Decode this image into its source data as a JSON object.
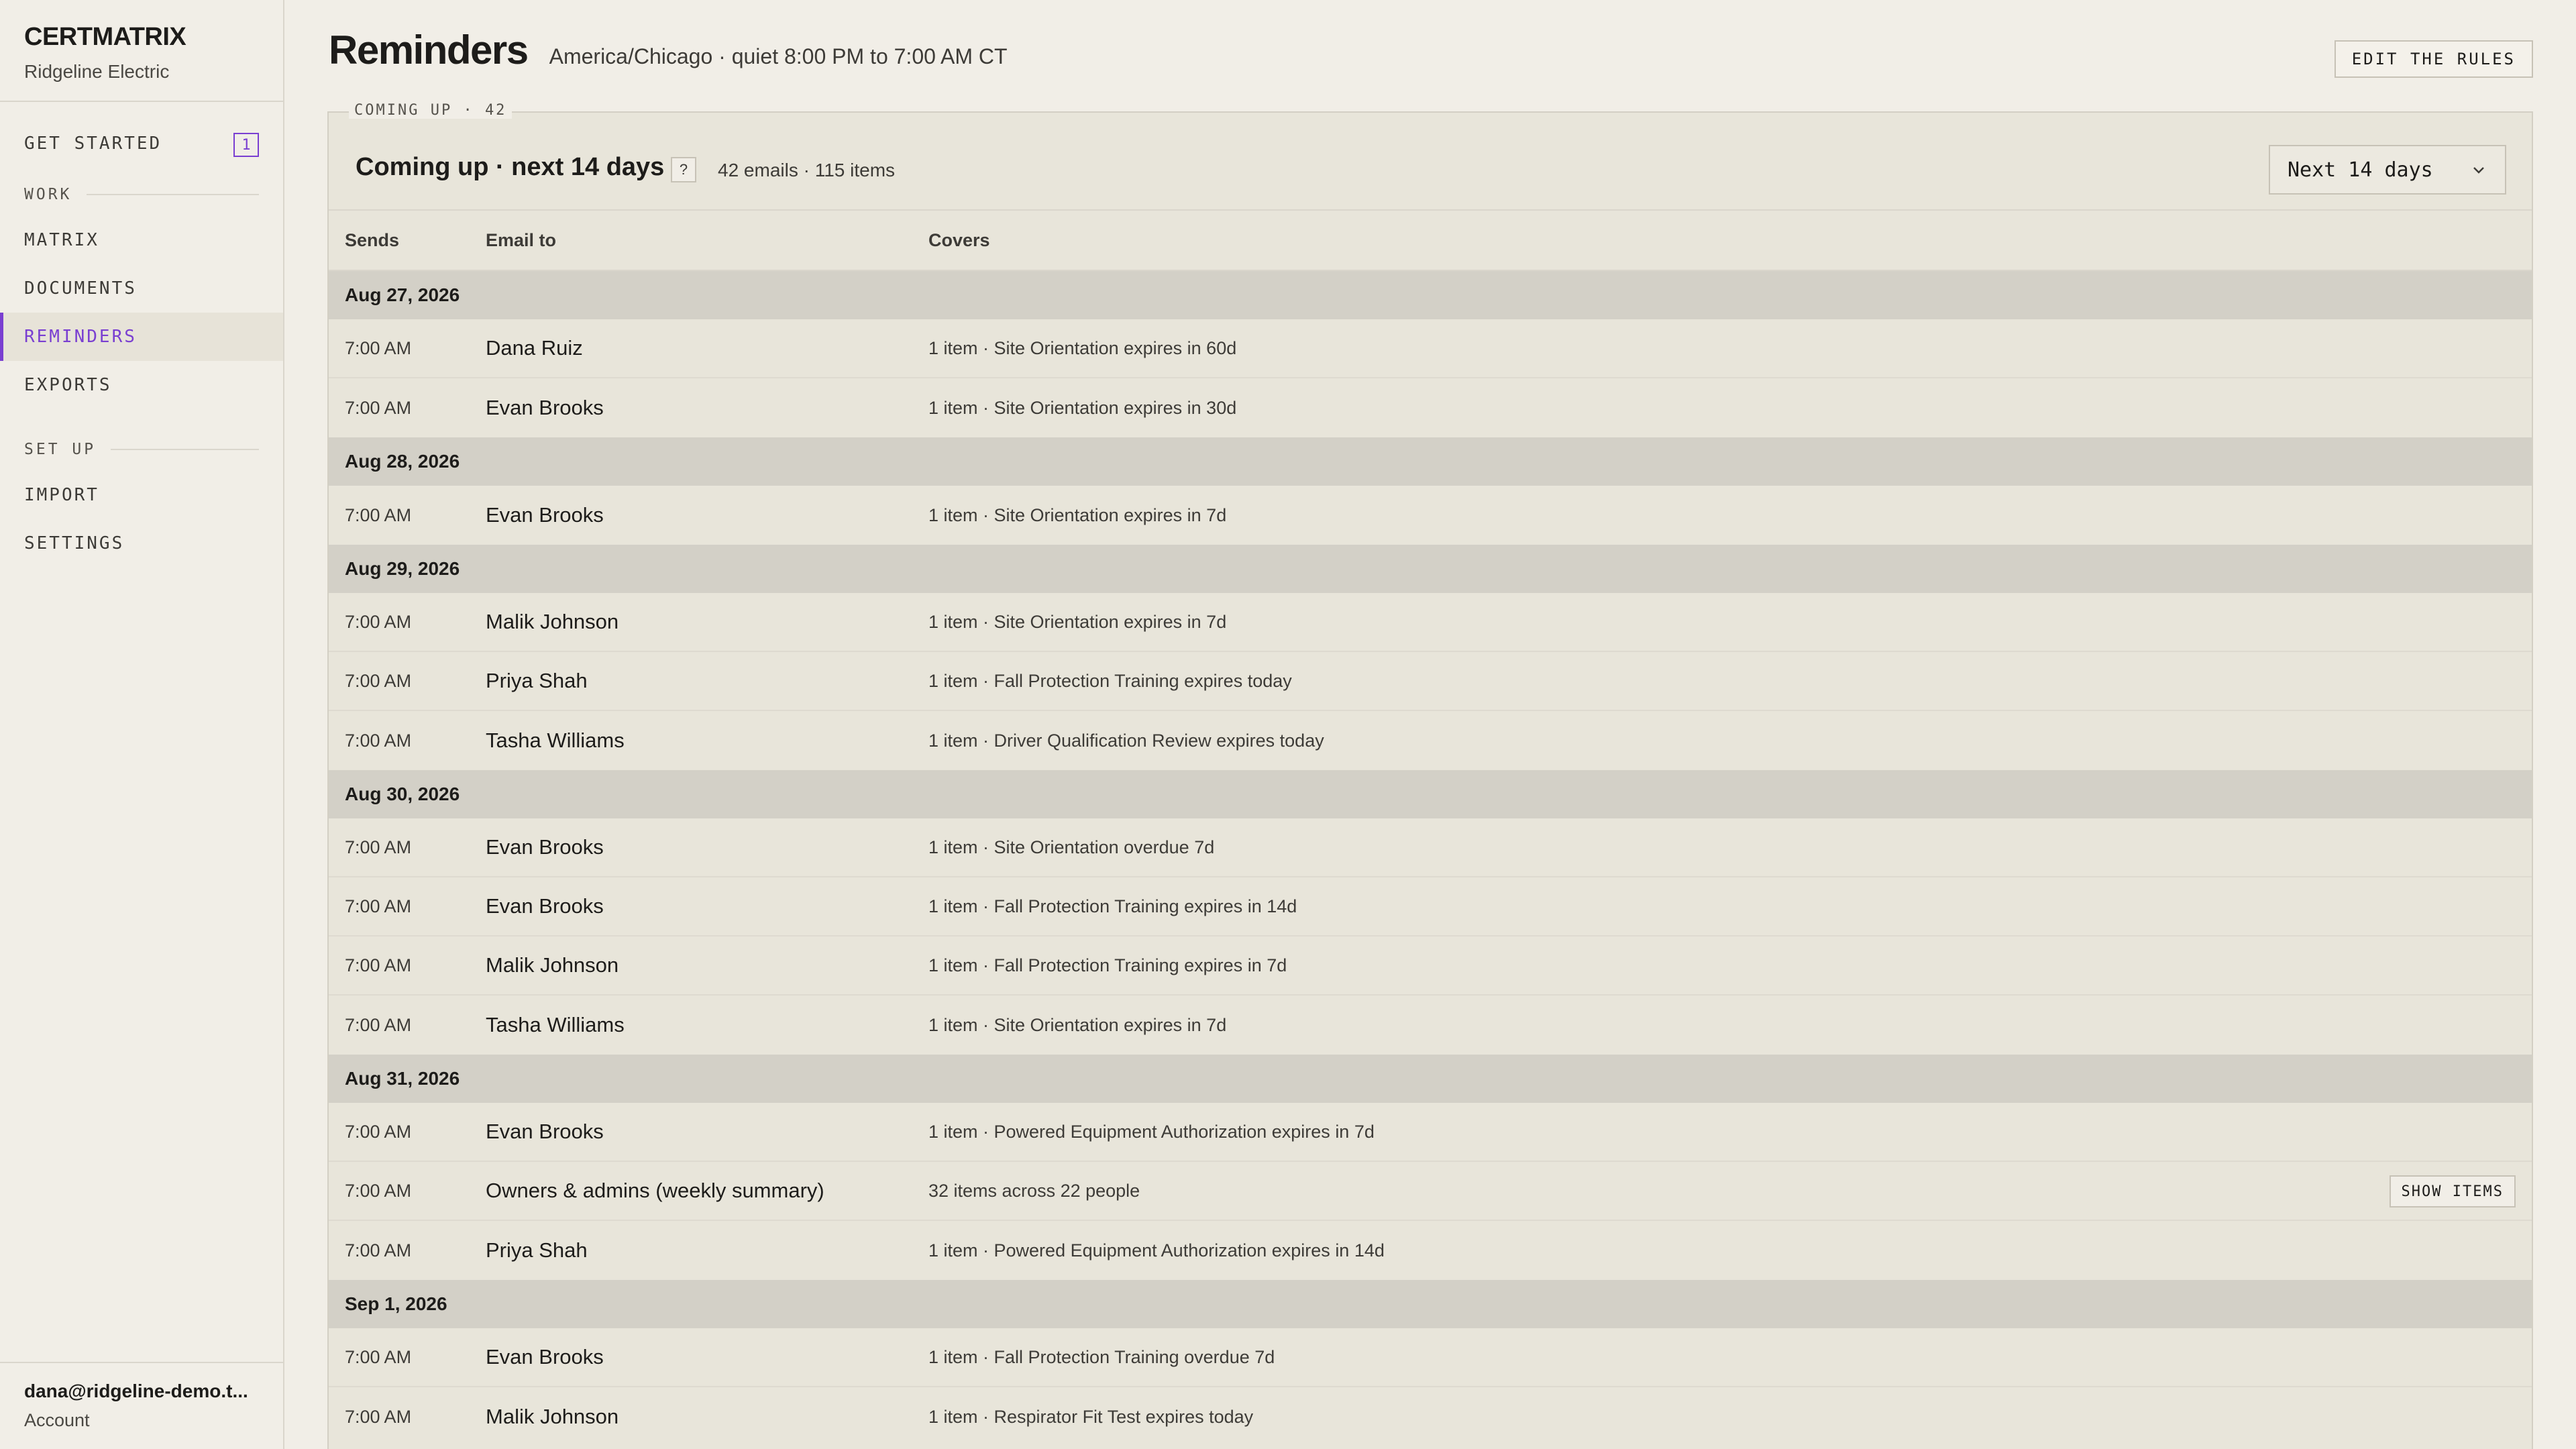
{
  "brand": {
    "name": "CERTMATRIX",
    "org": "Ridgeline Electric"
  },
  "sidebar": {
    "get_started": {
      "label": "GET STARTED",
      "badge": "1"
    },
    "sections": [
      {
        "label": "WORK",
        "items": [
          {
            "label": "MATRIX",
            "active": false
          },
          {
            "label": "DOCUMENTS",
            "active": false
          },
          {
            "label": "REMINDERS",
            "active": true
          },
          {
            "label": "EXPORTS",
            "active": false
          }
        ]
      },
      {
        "label": "SET UP",
        "items": [
          {
            "label": "IMPORT",
            "active": false
          },
          {
            "label": "SETTINGS",
            "active": false
          }
        ]
      }
    ],
    "account": {
      "email": "dana@ridgeline-demo.t...",
      "label": "Account"
    }
  },
  "header": {
    "title": "Reminders",
    "subtitle": "America/Chicago · quiet 8:00 PM to 7:00 AM CT",
    "edit_button": "EDIT THE RULES"
  },
  "panel": {
    "legend": "COMING UP · 42",
    "title": "Coming up · next 14 days",
    "help": "?",
    "meta": "42 emails · 115 items",
    "range_value": "Next 14 days",
    "columns": {
      "sends": "Sends",
      "to": "Email to",
      "covers": "Covers"
    },
    "show_items_label": "SHOW ITEMS",
    "groups": [
      {
        "date": "Aug 27, 2026",
        "rows": [
          {
            "time": "7:00 AM",
            "to": "Dana Ruiz",
            "covers": "1 item · Site Orientation expires in 60d"
          },
          {
            "time": "7:00 AM",
            "to": "Evan Brooks",
            "covers": "1 item · Site Orientation expires in 30d"
          }
        ]
      },
      {
        "date": "Aug 28, 2026",
        "rows": [
          {
            "time": "7:00 AM",
            "to": "Evan Brooks",
            "covers": "1 item · Site Orientation expires in 7d"
          }
        ]
      },
      {
        "date": "Aug 29, 2026",
        "rows": [
          {
            "time": "7:00 AM",
            "to": "Malik Johnson",
            "covers": "1 item · Site Orientation expires in 7d"
          },
          {
            "time": "7:00 AM",
            "to": "Priya Shah",
            "covers": "1 item · Fall Protection Training expires today"
          },
          {
            "time": "7:00 AM",
            "to": "Tasha Williams",
            "covers": "1 item · Driver Qualification Review expires today"
          }
        ]
      },
      {
        "date": "Aug 30, 2026",
        "rows": [
          {
            "time": "7:00 AM",
            "to": "Evan Brooks",
            "covers": "1 item · Site Orientation overdue 7d"
          },
          {
            "time": "7:00 AM",
            "to": "Evan Brooks",
            "covers": "1 item · Fall Protection Training expires in 14d"
          },
          {
            "time": "7:00 AM",
            "to": "Malik Johnson",
            "covers": "1 item · Fall Protection Training expires in 7d"
          },
          {
            "time": "7:00 AM",
            "to": "Tasha Williams",
            "covers": "1 item · Site Orientation expires in 7d"
          }
        ]
      },
      {
        "date": "Aug 31, 2026",
        "rows": [
          {
            "time": "7:00 AM",
            "to": "Evan Brooks",
            "covers": "1 item · Powered Equipment Authorization expires in 7d"
          },
          {
            "time": "7:00 AM",
            "to": "Owners & admins (weekly summary)",
            "covers": "32 items across 22 people",
            "show_items": true
          },
          {
            "time": "7:00 AM",
            "to": "Priya Shah",
            "covers": "1 item · Powered Equipment Authorization expires in 14d"
          }
        ]
      },
      {
        "date": "Sep 1, 2026",
        "rows": [
          {
            "time": "7:00 AM",
            "to": "Evan Brooks",
            "covers": "1 item · Fall Protection Training overdue 7d"
          },
          {
            "time": "7:00 AM",
            "to": "Malik Johnson",
            "covers": "1 item · Respirator Fit Test expires today"
          }
        ]
      }
    ]
  },
  "colors": {
    "accent": "#7a3fd1",
    "background": "#f1eee7",
    "panel": "#e8e5da",
    "group_row": "#d3d0c7"
  }
}
